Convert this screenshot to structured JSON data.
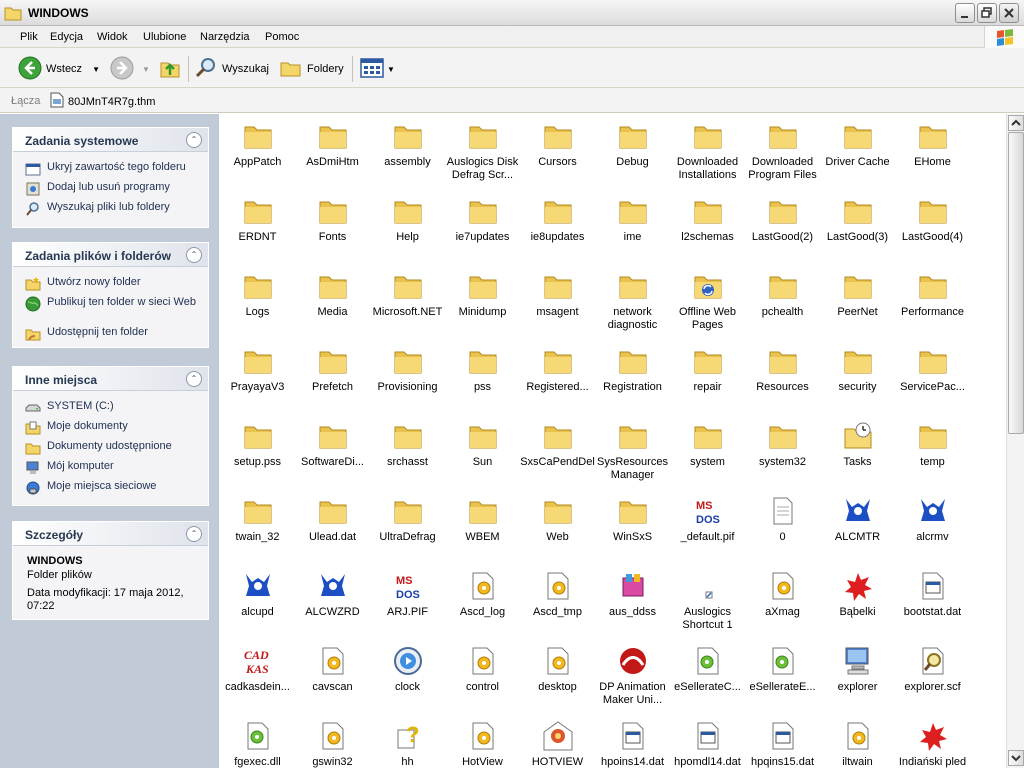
{
  "window": {
    "title": "WINDOWS",
    "icon": "folder-icon"
  },
  "menu": {
    "items": [
      "Plik",
      "Edycja",
      "Widok",
      "Ulubione",
      "Narzędzia",
      "Pomoc"
    ]
  },
  "toolbar": {
    "back_label": "Wstecz",
    "search_label": "Wyszukaj",
    "folders_label": "Foldery"
  },
  "links": {
    "label": "Łącza",
    "item": "80JMnT4R7g.thm"
  },
  "taskpane": {
    "system_tasks": {
      "title": "Zadania systemowe",
      "items": [
        "Ukryj zawartość tego folderu",
        "Dodaj lub usuń programy",
        "Wyszukaj pliki lub foldery"
      ]
    },
    "file_tasks": {
      "title": "Zadania plików i folderów",
      "items": [
        "Utwórz nowy folder",
        "Publikuj ten folder w sieci Web",
        "Udostępnij ten folder"
      ]
    },
    "other_places": {
      "title": "Inne miejsca",
      "items": [
        "SYSTEM (C:)",
        "Moje dokumenty",
        "Dokumenty udostępnione",
        "Mój komputer",
        "Moje miejsca sieciowe"
      ]
    },
    "details": {
      "title": "Szczegóły",
      "name": "WINDOWS",
      "type": "Folder plików",
      "modified": "Data modyfikacji: 17 maja 2012, 07:22"
    }
  },
  "files": [
    {
      "name": "AppPatch",
      "icon": "folder"
    },
    {
      "name": "AsDmiHtm",
      "icon": "folder"
    },
    {
      "name": "assembly",
      "icon": "folder"
    },
    {
      "name": "Auslogics Disk Defrag Scr...",
      "icon": "folder"
    },
    {
      "name": "Cursors",
      "icon": "folder"
    },
    {
      "name": "Debug",
      "icon": "folder"
    },
    {
      "name": "Downloaded Installations",
      "icon": "folder"
    },
    {
      "name": "Downloaded Program Files",
      "icon": "folder"
    },
    {
      "name": "Driver Cache",
      "icon": "folder"
    },
    {
      "name": "EHome",
      "icon": "folder"
    },
    {
      "name": "ERDNT",
      "icon": "folder"
    },
    {
      "name": "Fonts",
      "icon": "folder"
    },
    {
      "name": "Help",
      "icon": "folder"
    },
    {
      "name": "ie7updates",
      "icon": "folder"
    },
    {
      "name": "ie8updates",
      "icon": "folder"
    },
    {
      "name": "ime",
      "icon": "folder"
    },
    {
      "name": "l2schemas",
      "icon": "folder"
    },
    {
      "name": "LastGood(2)",
      "icon": "folder"
    },
    {
      "name": "LastGood(3)",
      "icon": "folder"
    },
    {
      "name": "LastGood(4)",
      "icon": "folder"
    },
    {
      "name": "Logs",
      "icon": "folder"
    },
    {
      "name": "Media",
      "icon": "folder"
    },
    {
      "name": "Microsoft.NET",
      "icon": "folder"
    },
    {
      "name": "Minidump",
      "icon": "folder"
    },
    {
      "name": "msagent",
      "icon": "folder"
    },
    {
      "name": "network diagnostic",
      "icon": "folder"
    },
    {
      "name": "Offline Web Pages",
      "icon": "folder-sync"
    },
    {
      "name": "pchealth",
      "icon": "folder"
    },
    {
      "name": "PeerNet",
      "icon": "folder"
    },
    {
      "name": "Performance",
      "icon": "folder"
    },
    {
      "name": "PrayayaV3",
      "icon": "folder"
    },
    {
      "name": "Prefetch",
      "icon": "folder"
    },
    {
      "name": "Provisioning",
      "icon": "folder"
    },
    {
      "name": "pss",
      "icon": "folder"
    },
    {
      "name": "Registered...",
      "icon": "folder"
    },
    {
      "name": "Registration",
      "icon": "folder"
    },
    {
      "name": "repair",
      "icon": "folder"
    },
    {
      "name": "Resources",
      "icon": "folder"
    },
    {
      "name": "security",
      "icon": "folder"
    },
    {
      "name": "ServicePac...",
      "icon": "folder"
    },
    {
      "name": "setup.pss",
      "icon": "folder"
    },
    {
      "name": "SoftwareDi...",
      "icon": "folder"
    },
    {
      "name": "srchasst",
      "icon": "folder"
    },
    {
      "name": "Sun",
      "icon": "folder"
    },
    {
      "name": "SxsCaPendDel",
      "icon": "folder"
    },
    {
      "name": "SysResources Manager",
      "icon": "folder"
    },
    {
      "name": "system",
      "icon": "folder"
    },
    {
      "name": "system32",
      "icon": "folder"
    },
    {
      "name": "Tasks",
      "icon": "folder-tasks"
    },
    {
      "name": "temp",
      "icon": "folder"
    },
    {
      "name": "twain_32",
      "icon": "folder"
    },
    {
      "name": "Ulead.dat",
      "icon": "folder"
    },
    {
      "name": "UltraDefrag",
      "icon": "folder"
    },
    {
      "name": "WBEM",
      "icon": "folder"
    },
    {
      "name": "Web",
      "icon": "folder"
    },
    {
      "name": "WinSxS",
      "icon": "folder"
    },
    {
      "name": "_default.pif",
      "icon": "msdos"
    },
    {
      "name": "0",
      "icon": "document"
    },
    {
      "name": "ALCMTR",
      "icon": "realtek"
    },
    {
      "name": "alcrmv",
      "icon": "realtek"
    },
    {
      "name": "alcupd",
      "icon": "realtek"
    },
    {
      "name": "ALCWZRD",
      "icon": "realtek"
    },
    {
      "name": "ARJ.PIF",
      "icon": "msdos"
    },
    {
      "name": "Ascd_log",
      "icon": "settings-file"
    },
    {
      "name": "Ascd_tmp",
      "icon": "settings-file"
    },
    {
      "name": "aus_ddss",
      "icon": "installer"
    },
    {
      "name": "Auslogics Shortcut 1",
      "icon": "shortcut"
    },
    {
      "name": "aXmag",
      "icon": "settings-file"
    },
    {
      "name": "Bąbelki",
      "icon": "red-splat"
    },
    {
      "name": "bootstat.dat",
      "icon": "dat-file"
    },
    {
      "name": "cadkasdein...",
      "icon": "cadkas"
    },
    {
      "name": "cavscan",
      "icon": "settings-file"
    },
    {
      "name": "clock",
      "icon": "clock"
    },
    {
      "name": "control",
      "icon": "settings-file"
    },
    {
      "name": "desktop",
      "icon": "settings-file"
    },
    {
      "name": "DP Animation Maker Uni...",
      "icon": "dp-animation"
    },
    {
      "name": "eSellerateC...",
      "icon": "dll-file"
    },
    {
      "name": "eSellerateE...",
      "icon": "dll-file"
    },
    {
      "name": "explorer",
      "icon": "computer"
    },
    {
      "name": "explorer.scf",
      "icon": "search-file"
    },
    {
      "name": "fgexec.dll",
      "icon": "dll-file"
    },
    {
      "name": "gswin32",
      "icon": "settings-file"
    },
    {
      "name": "hh",
      "icon": "help"
    },
    {
      "name": "HotView",
      "icon": "settings-file"
    },
    {
      "name": "HOTVIEW",
      "icon": "hotview"
    },
    {
      "name": "hpoins14.dat",
      "icon": "dat-file"
    },
    {
      "name": "hpomdl14.dat",
      "icon": "dat-file"
    },
    {
      "name": "hpqins15.dat",
      "icon": "dat-file"
    },
    {
      "name": "iltwain",
      "icon": "settings-file"
    },
    {
      "name": "Indiański pled",
      "icon": "red-splat"
    }
  ]
}
